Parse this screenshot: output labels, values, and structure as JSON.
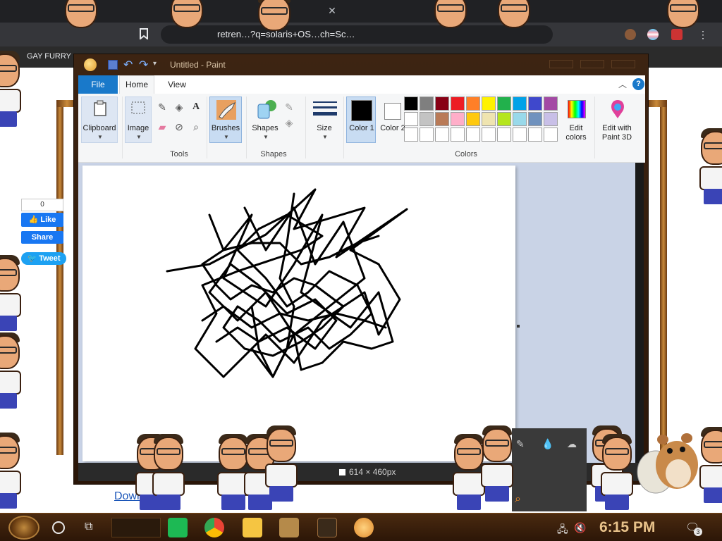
{
  "browser": {
    "tab_close": "✕",
    "address_text": "retren…?q=solaris+OS…ch=Sc…",
    "bookmark_label": "GAY FURRY"
  },
  "webpage": {
    "like_count": "0",
    "like_label": "Like",
    "share_label": "Share",
    "tweet_label": "Tweet",
    "download_label": "Down"
  },
  "paint": {
    "title": "Untitled - Paint",
    "tabs": {
      "file": "File",
      "home": "Home",
      "view": "View"
    },
    "help": "?",
    "groups": {
      "clipboard": "Clipboard",
      "image": "Image",
      "tools": "Tools",
      "brushes": "Brushes",
      "shapes": "Shapes",
      "size": "Size",
      "color1": "Color 1",
      "color2": "Color 2",
      "colors": "Colors",
      "edit_colors": "Edit colors",
      "edit_paint3d": "Edit with Paint 3D"
    },
    "tools_group_label": "Tools",
    "shapes_group_label": "Shapes",
    "colors_group_label": "Colors",
    "palette": [
      [
        "#000000",
        "#7f7f7f",
        "#880015",
        "#ed1c24",
        "#ff7f27",
        "#fff200",
        "#22b14c",
        "#00a2e8",
        "#3f48cc",
        "#a349a4"
      ],
      [
        "#ffffff",
        "#c3c3c3",
        "#b97a57",
        "#ffaec9",
        "#ffc90e",
        "#efe4b0",
        "#b5e61d",
        "#99d9ea",
        "#7092be",
        "#c8bfe7"
      ],
      [
        "#ffffff",
        "#ffffff",
        "#ffffff",
        "#ffffff",
        "#ffffff",
        "#ffffff",
        "#ffffff",
        "#ffffff",
        "#ffffff",
        "#ffffff"
      ]
    ],
    "color1": "#000000",
    "color2": "#ffffff",
    "status_size": "614 × 460px"
  },
  "taskbar": {
    "clock": "6:15 PM",
    "notification_count": "3"
  }
}
